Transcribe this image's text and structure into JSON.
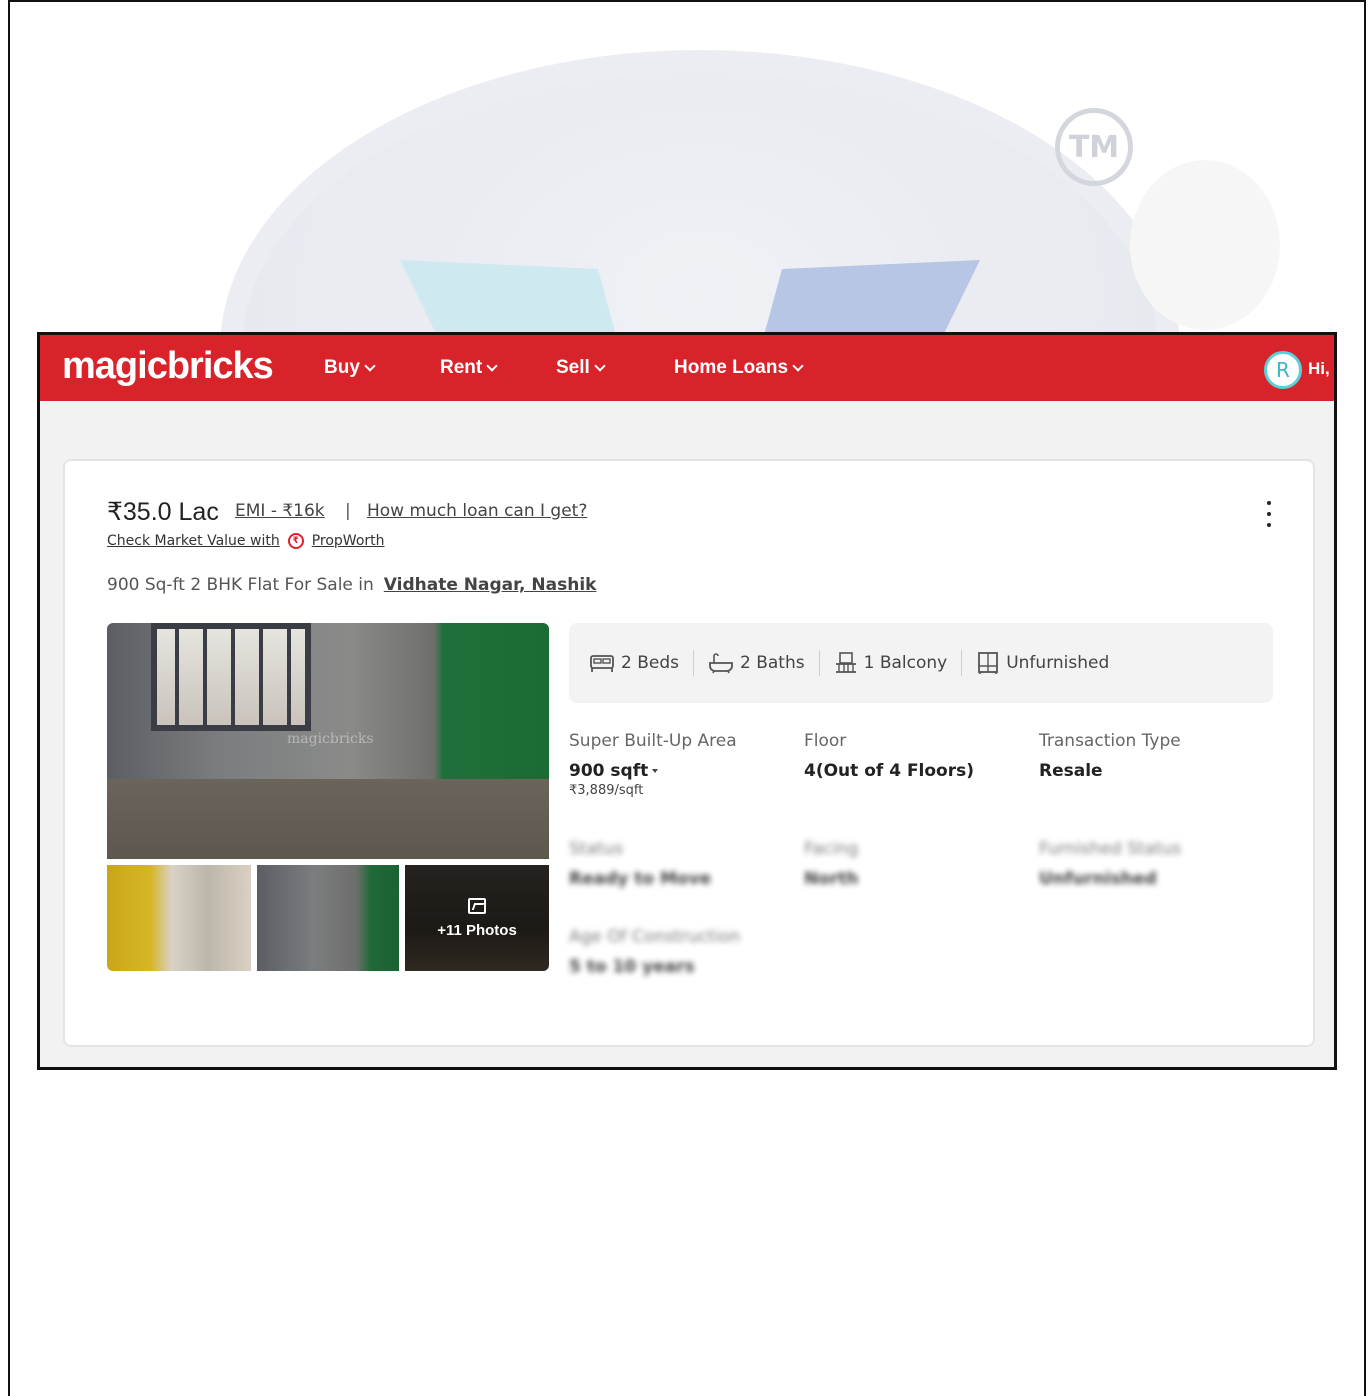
{
  "watermark": {
    "tm": "TM"
  },
  "navbar": {
    "logo": "magicbricks",
    "items": [
      "Buy",
      "Rent",
      "Sell",
      "Home Loans"
    ],
    "avatar_initial": "R",
    "greeting": "Hi,"
  },
  "listing": {
    "price": "₹35.0 Lac",
    "emi": "EMI - ₹16k",
    "separator": "|",
    "loan_link": "How much loan can I get?",
    "market_value": "Check Market Value with",
    "propworth": "PropWorth",
    "title": "900 Sq-ft 2 BHK Flat For Sale in",
    "location": "Vidhate Nagar, Nashik",
    "photo_watermark": "magicbricks",
    "more_photos": "+11 Photos",
    "amenities": [
      {
        "icon": "bed-icon",
        "label": "2 Beds"
      },
      {
        "icon": "bath-icon",
        "label": "2 Baths"
      },
      {
        "icon": "balcony-icon",
        "label": "1 Balcony"
      },
      {
        "icon": "wardrobe-icon",
        "label": "Unfurnished"
      }
    ],
    "facts": [
      {
        "label": "Super Built-Up Area",
        "value": "900 sqft",
        "sub": "₹3,889/sqft"
      },
      {
        "label": "Floor",
        "value": "4(Out of 4 Floors)"
      },
      {
        "label": "Transaction Type",
        "value": "Resale"
      },
      {
        "label": "Status",
        "value": "Ready to Move"
      },
      {
        "label": "Facing",
        "value": "North"
      },
      {
        "label": "Furnished Status",
        "value": "Unfurnished"
      },
      {
        "label": "Age Of Construction",
        "value": "5 to 10 years"
      }
    ]
  },
  "colors": {
    "brand": "#d8232a",
    "avatar_ring": "#5bd0d8"
  }
}
